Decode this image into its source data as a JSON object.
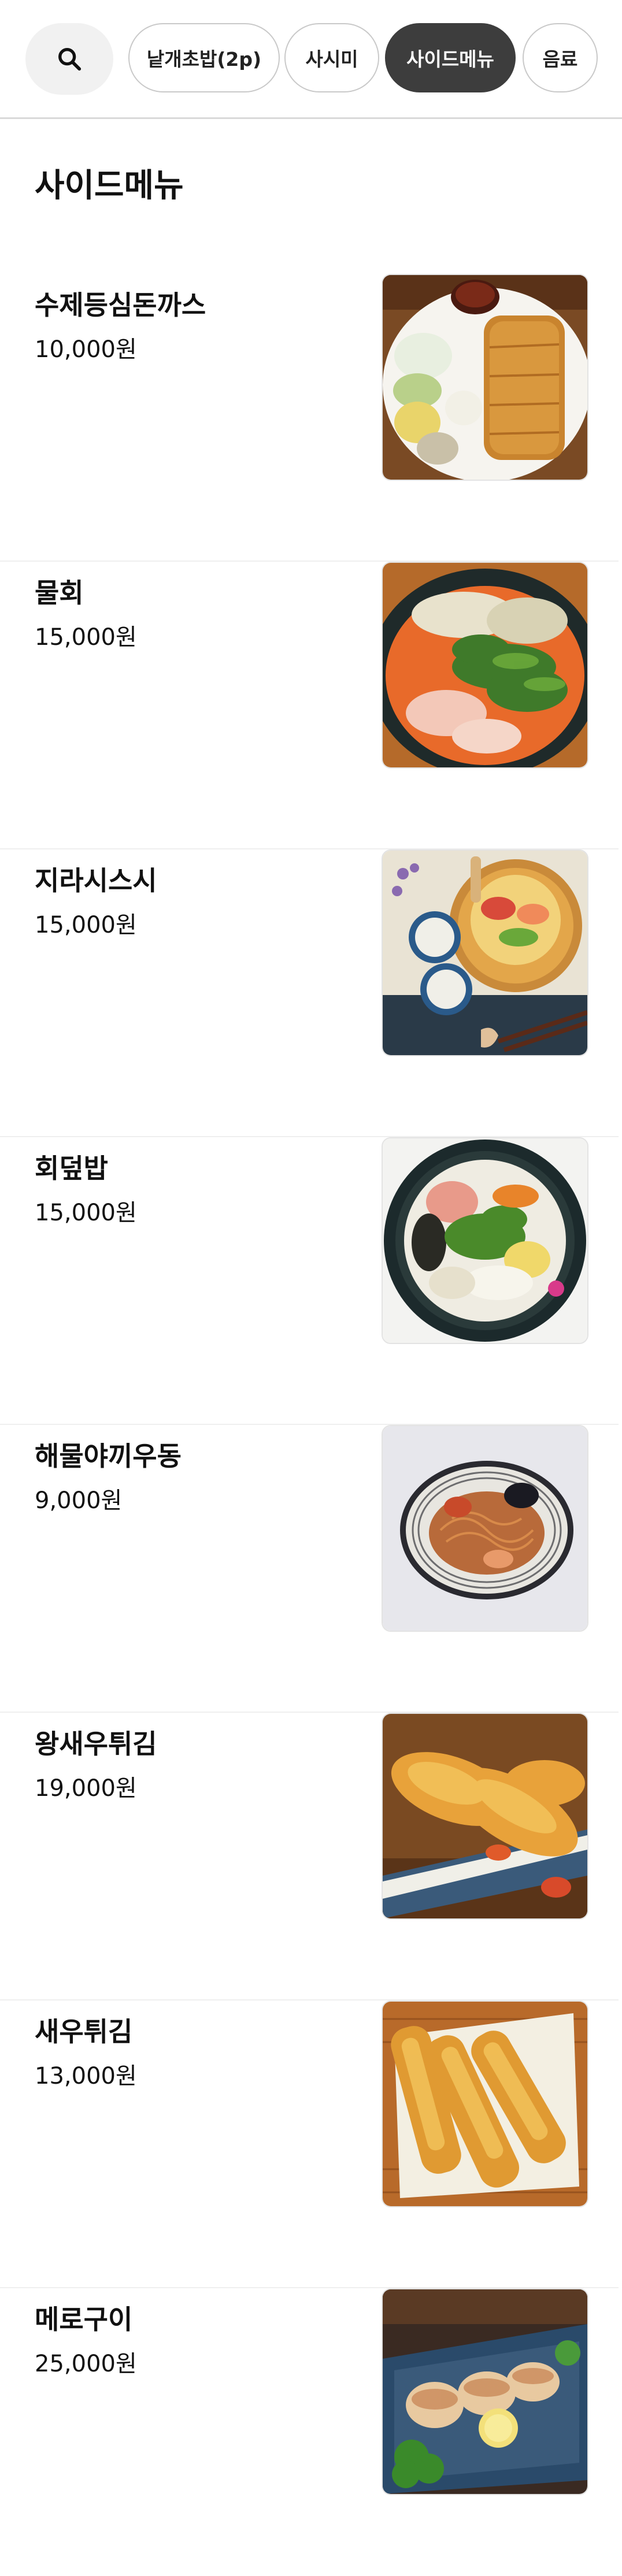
{
  "tabs": [
    {
      "label": "낱개초밥(2p)",
      "active": false
    },
    {
      "label": "사시미",
      "active": false
    },
    {
      "label": "사이드메뉴",
      "active": true
    },
    {
      "label": "음료",
      "active": false
    }
  ],
  "search": {
    "icon": "search-icon"
  },
  "section": {
    "title": "사이드메뉴"
  },
  "items": [
    {
      "name": "수제등심돈까스",
      "price": "10,000원",
      "image": "tonkatsu-plate-photo"
    },
    {
      "name": "물회",
      "price": "15,000원",
      "image": "mulhoe-bowl-photo"
    },
    {
      "name": "지라시스시",
      "price": "15,000원",
      "image": "chirashi-sushi-photo"
    },
    {
      "name": "회덮밥",
      "price": "15,000원",
      "image": "hoedeopbap-bowl-photo"
    },
    {
      "name": "해물야끼우동",
      "price": "9,000원",
      "image": "seafood-yaki-udon-photo"
    },
    {
      "name": "왕새우튀김",
      "price": "19,000원",
      "image": "king-shrimp-tempura-photo"
    },
    {
      "name": "새우튀김",
      "price": "13,000원",
      "image": "shrimp-tempura-photo"
    },
    {
      "name": "메로구이",
      "price": "25,000원",
      "image": "grilled-mero-photo"
    }
  ],
  "colors": {
    "active_tab_bg": "#3d3d3d",
    "search_bg": "#f1f1f1",
    "text": "#111111"
  }
}
